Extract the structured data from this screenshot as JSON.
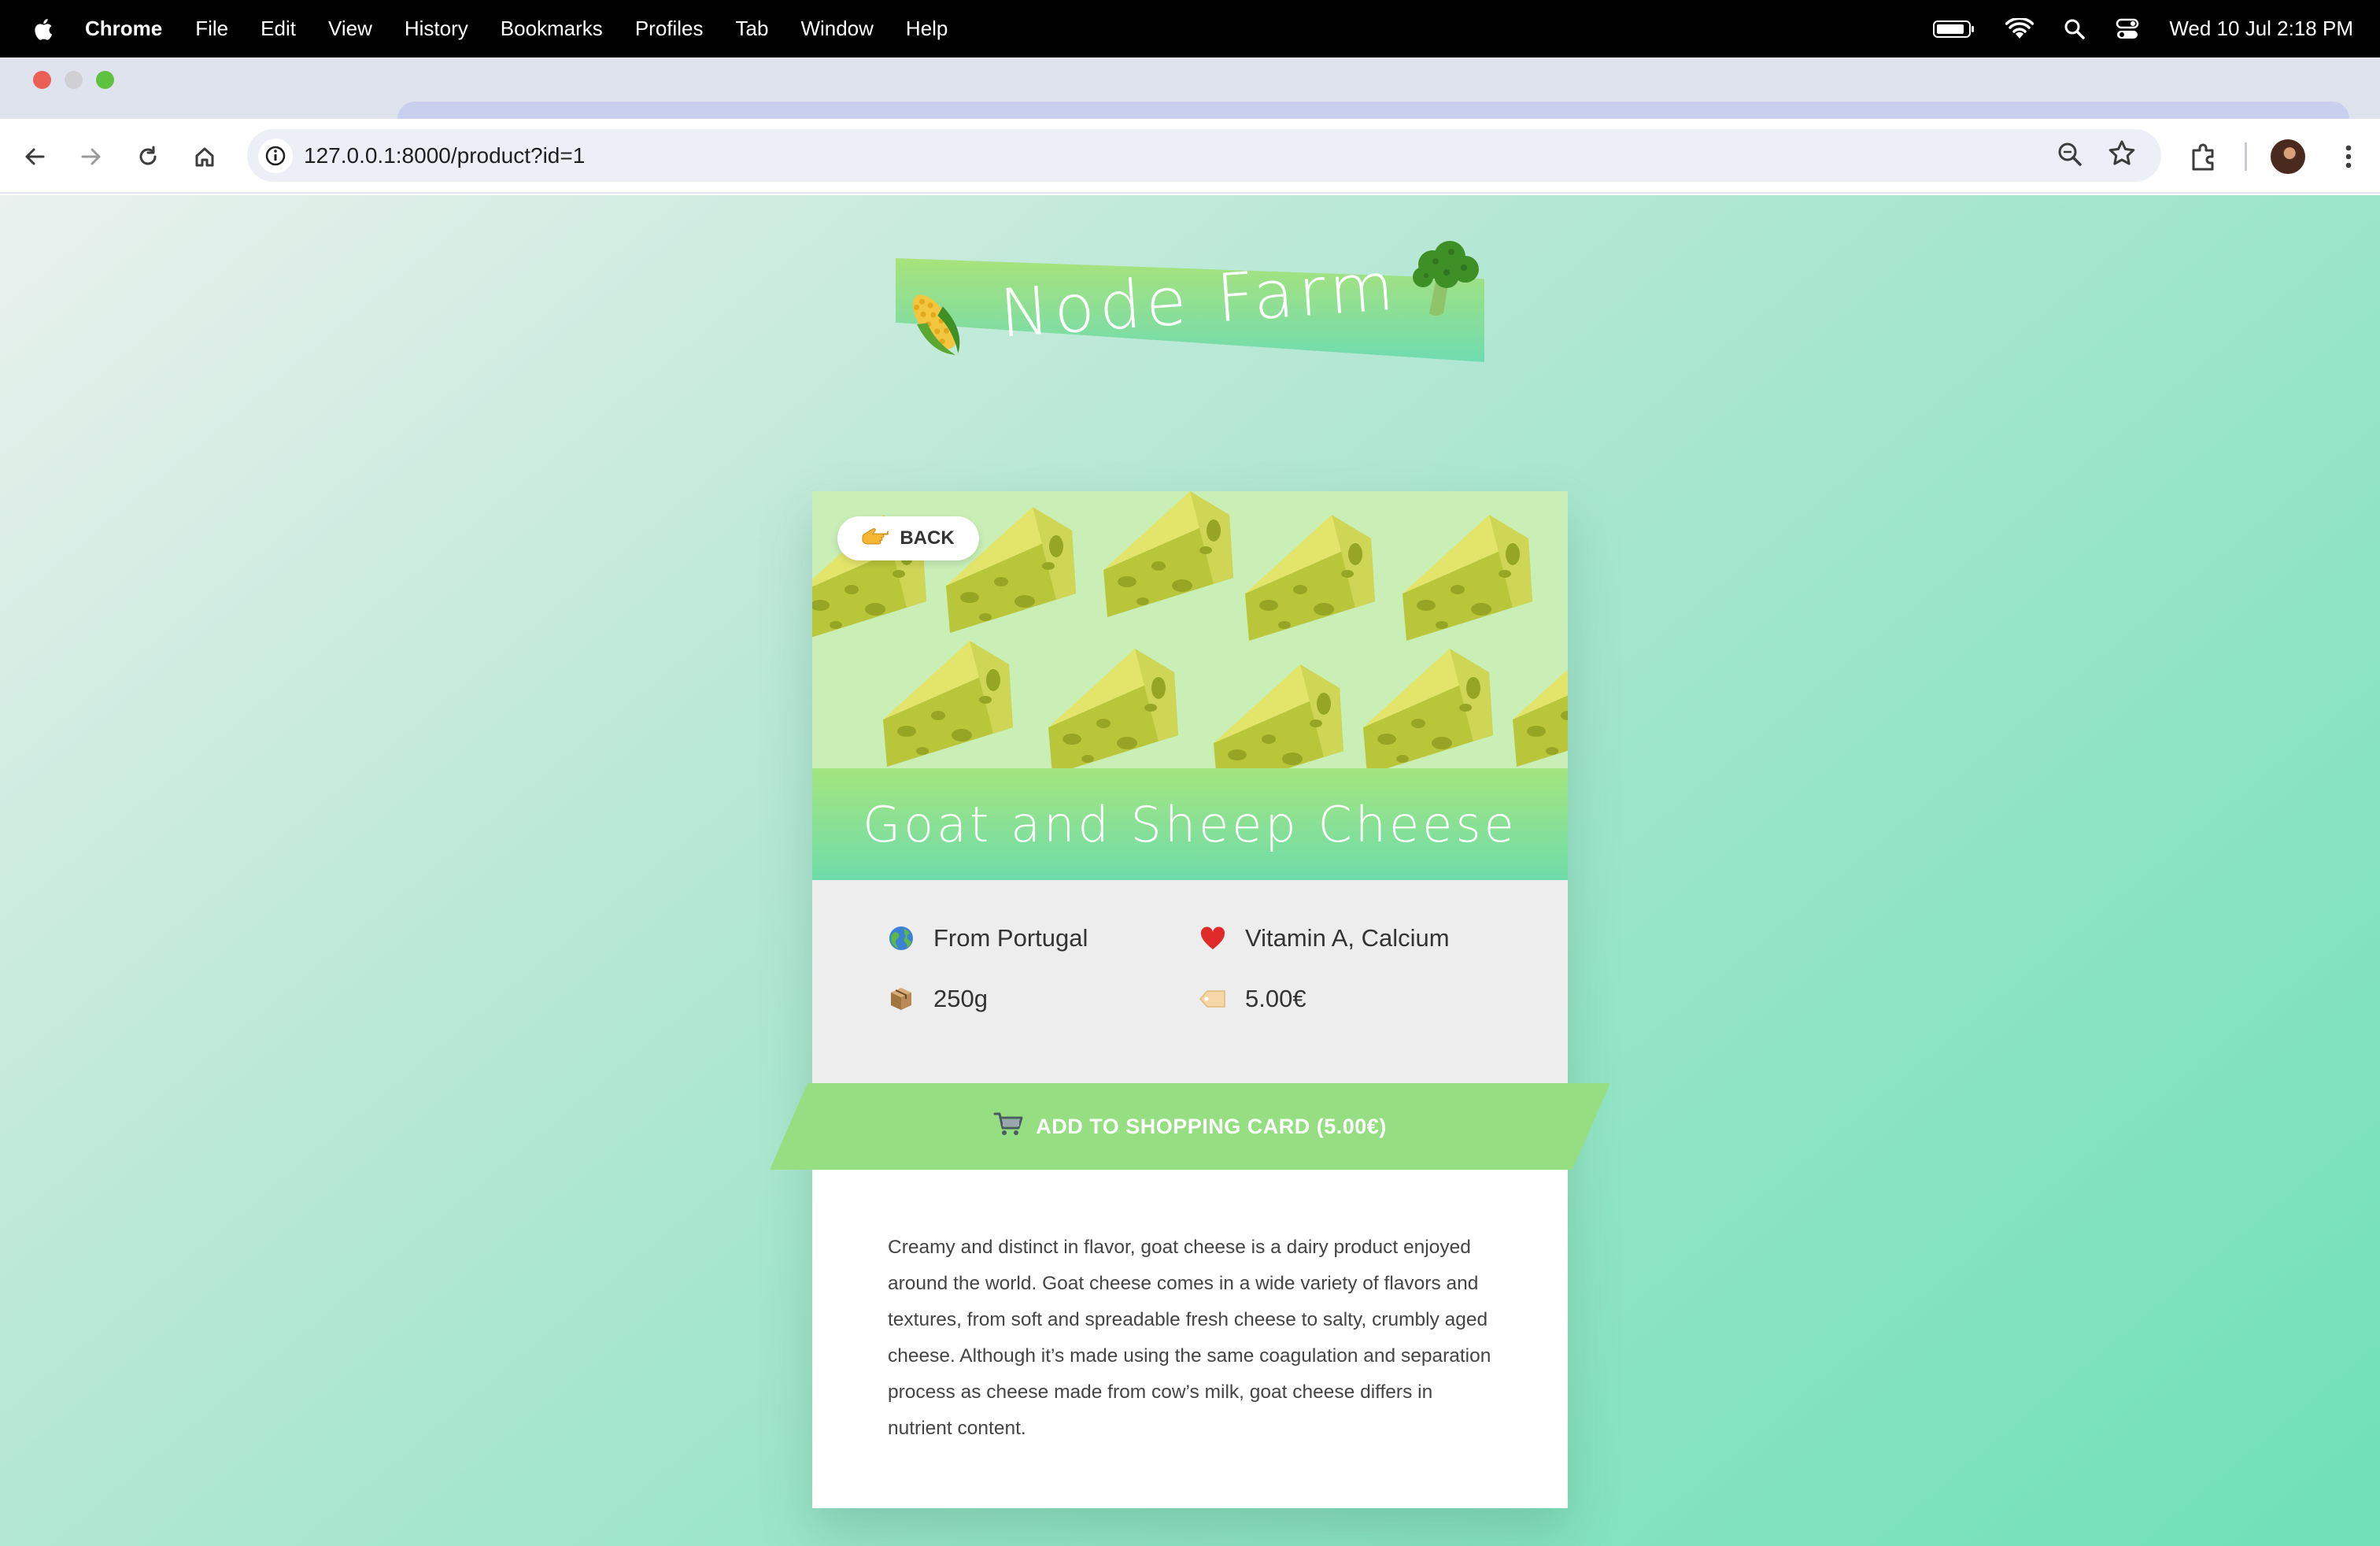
{
  "menubar": {
    "app_name": "Chrome",
    "items": [
      "File",
      "Edit",
      "View",
      "History",
      "Bookmarks",
      "Profiles",
      "Tab",
      "Window",
      "Help"
    ],
    "clock": "Wed 10 Jul  2:18 PM"
  },
  "browser": {
    "url": "127.0.0.1:8000/product?id=1"
  },
  "site": {
    "logo_text": "Node Farm"
  },
  "product": {
    "back_label": "BACK",
    "name": "Goat and Sheep Cheese",
    "origin": "From Portugal",
    "nutrients": "Vitamin A, Calcium",
    "quantity": "250g",
    "price": "5.00€",
    "cart_label": "ADD TO SHOPPING CARD (5.00€)",
    "description": "Creamy and distinct in flavor, goat cheese is a dairy product enjoyed around the world. Goat cheese comes in a wide variety of flavors and textures, from soft and spreadable fresh cheese to salty, crumbly aged cheese. Although it’s made using the same coagulation and separation process as cheese made from cow’s milk, goat cheese differs in nutrient content."
  },
  "icons": {
    "origin": "globe-icon",
    "nutrients": "heart-icon",
    "quantity": "package-icon",
    "price": "price-tag-icon"
  },
  "colors": {
    "accent_green": "#95df82",
    "title_gradient_top": "#a3e57e",
    "title_gradient_bottom": "#6fdcaa"
  }
}
